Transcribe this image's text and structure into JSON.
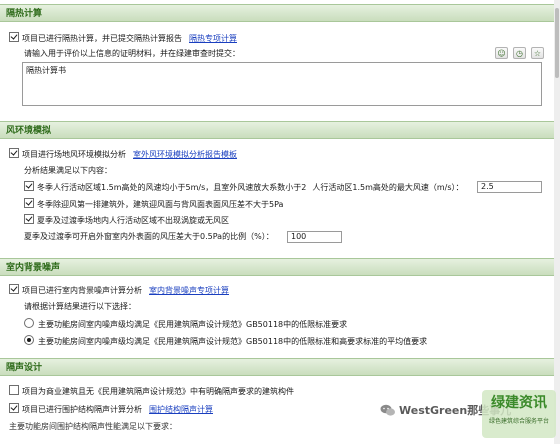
{
  "sections": {
    "insulation": {
      "header": "隔热计算",
      "check_label": "项目已进行隔热计算，并已提交隔热计算报告",
      "link": "隔热专项计算",
      "prompt": "请输入用于评价以上信息的证明材料，并在绿建审查时提交：",
      "textarea_value": "隔热计算书"
    },
    "wind": {
      "header": "风环境模拟",
      "check_label": "项目进行场地风环境模拟分析",
      "link": "室外风环境模拟分析报告模板",
      "satisfy_label": "分析结果满足以下内容：",
      "item1_label": "冬季人行活动区域1.5m高处的风速均小于5m/s，且室外风速放大系数小于2",
      "item1_tail": "人行活动区1.5m高处的最大风速（m/s）：",
      "item1_value": "2.5",
      "item2_label": "冬季除迎风第一排建筑外，建筑迎风面与背风面表面风压差不大于5Pa",
      "item3_label": "夏季及过渡季场地内人行活动区域不出现涡旋或无风区",
      "ratio_label": "夏季及过渡季可开启外窗室内外表面的风压差大于0.5Pa的比例（%）：",
      "ratio_value": "100"
    },
    "noise": {
      "header": "室内背景噪声",
      "check_label": "项目已进行室内背景噪声计算分析",
      "link": "室内背景噪声专项计算",
      "select_prompt": "请根据计算结果进行以下选择：",
      "radio1": "主要功能房间室内噪声级均满足《民用建筑隔声设计规范》GB50118中的低限标准要求",
      "radio2": "主要功能房间室内噪声级均满足《民用建筑隔声设计规范》GB50118中的低限标准和高要求标准的平均值要求"
    },
    "sound": {
      "header": "隔声设计",
      "check1": "项目为商业建筑且无《民用建筑隔声设计规范》中有明确隔声要求的建筑构件",
      "check2": "项目已进行围护结构隔声计算分析",
      "link": "围护结构隔声计算",
      "partial": "主要功能房间围护结构隔声性能满足以下要求："
    }
  },
  "watermark": {
    "text": "WestGreen那些事儿",
    "stamp": "绿建资讯",
    "stamp_sub": "绿色建筑综合服务平台"
  },
  "colors": {
    "header_text": "#2e6b1a",
    "link": "#1a3fbf",
    "accent_green": "#3b8a2a"
  }
}
